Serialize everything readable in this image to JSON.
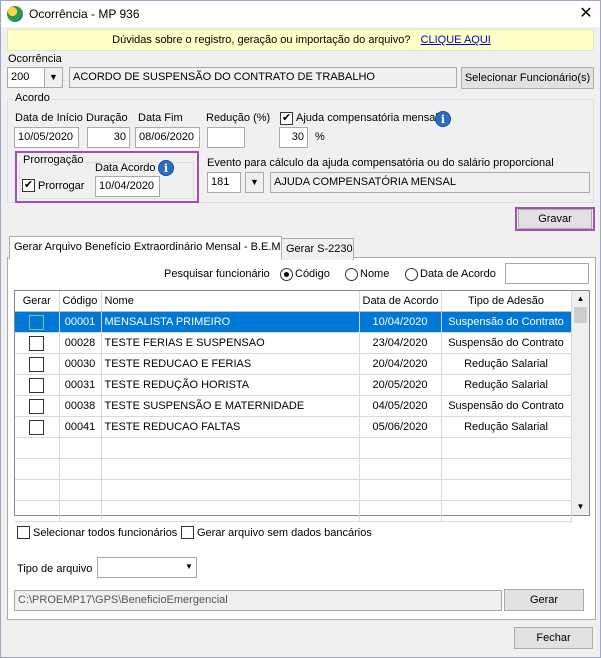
{
  "window": {
    "title": "Ocorrência - MP 936",
    "close": "✕"
  },
  "banner": {
    "text": "Dúvidas sobre o registro, geração ou importação do arquivo?",
    "link": "CLIQUE AQUI"
  },
  "ocorrencia": {
    "label": "Ocorrência",
    "code": "200",
    "description": "ACORDO DE SUSPENSÃO DO CONTRATO DE TRABALHO",
    "select_button": "Selecionar Funcionário(s)"
  },
  "acordo": {
    "legend": "Acordo",
    "data_inicio_label": "Data de Início",
    "data_inicio": "10/05/2020",
    "duracao_label": "Duração",
    "duracao": "30",
    "data_fim_label": "Data Fim",
    "data_fim": "08/06/2020",
    "reducao_label": "Redução (%)",
    "reducao": "",
    "ajuda_label": "Ajuda compensatória mensal",
    "ajuda_checked": true,
    "ajuda_value": "30",
    "percent": "%"
  },
  "prorrogacao": {
    "legend": "Prorrogação",
    "checkbox_label": "Prorrogar",
    "checked": true,
    "data_acordo_label": "Data Acordo",
    "data_acordo": "10/04/2020"
  },
  "evento": {
    "label": "Evento para cálculo da ajuda compensatória ou do salário proporcional",
    "code": "181",
    "description": "AJUDA COMPENSATÓRIA MENSAL"
  },
  "gravar": "Gravar",
  "tabs": [
    {
      "label": "Gerar Arquivo Benefício Extraordinário Mensal - B.E.M",
      "active": true
    },
    {
      "label": "Gerar S-2230",
      "active": false
    }
  ],
  "search": {
    "label": "Pesquisar funcionário",
    "options": [
      "Código",
      "Nome",
      "Data de Acordo"
    ],
    "selected": "Código",
    "value": ""
  },
  "grid": {
    "columns": [
      "Gerar",
      "Código",
      "Nome",
      "Data de Acordo",
      "Tipo de Adesão"
    ],
    "rows": [
      {
        "codigo": "00001",
        "nome": "MENSALISTA PRIMEIRO",
        "data": "10/04/2020",
        "tipo": "Suspensão do Contrato",
        "selected": true
      },
      {
        "codigo": "00028",
        "nome": "TESTE FERIAS E SUSPENSAO",
        "data": "23/04/2020",
        "tipo": "Suspensão do Contrato",
        "selected": false
      },
      {
        "codigo": "00030",
        "nome": "TESTE REDUCAO E FERIAS",
        "data": "20/04/2020",
        "tipo": "Redução Salarial",
        "selected": false
      },
      {
        "codigo": "00031",
        "nome": "TESTE REDUÇÃO HORISTA",
        "data": "20/05/2020",
        "tipo": "Redução Salarial",
        "selected": false
      },
      {
        "codigo": "00038",
        "nome": "TESTE SUSPENSÃO E MATERNIDADE",
        "data": "04/05/2020",
        "tipo": "Suspensão do Contrato",
        "selected": false
      },
      {
        "codigo": "00041",
        "nome": "TESTE REDUCAO FALTAS",
        "data": "05/06/2020",
        "tipo": "Redução Salarial",
        "selected": false
      }
    ]
  },
  "options": {
    "select_all": "Selecionar todos funcionários",
    "no_bank": "Gerar arquivo sem dados bancários"
  },
  "tipo_arquivo": {
    "label": "Tipo de arquivo",
    "value": ""
  },
  "path": {
    "value": "C:\\PROEMP17\\GPS\\BeneficioEmergencial",
    "gerar": "Gerar"
  },
  "fechar": "Fechar",
  "colors": {
    "highlight": "#a050b0",
    "selection": "#0078d7",
    "banner": "#ffffc8",
    "link": "#0000cc"
  }
}
